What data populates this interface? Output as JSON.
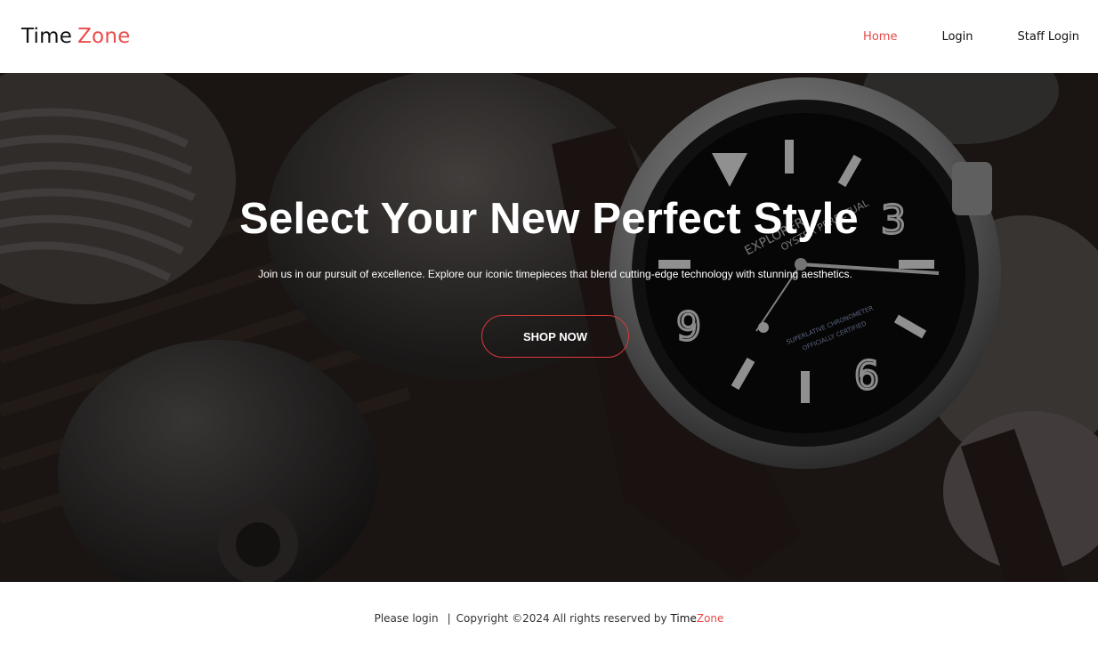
{
  "header": {
    "logo_part1": "Time",
    "logo_part2": "Zone",
    "nav": {
      "home": "Home",
      "login": "Login",
      "staff_login": "Staff Login"
    }
  },
  "hero": {
    "title": "Select Your New Perfect Style",
    "subtitle": "Join us in our pursuit of excellence. Explore our iconic timepieces that blend cutting-edge technology with stunning aesthetics.",
    "cta": "SHOP NOW",
    "watch_dial_brand": "OYSTER PERPETUAL",
    "watch_dial_model": "EXPLORER",
    "watch_dial_line1": "SUPERLATIVE CHRONOMETER",
    "watch_dial_line2": "OFFICIALLY CERTIFIED"
  },
  "footer": {
    "please_login": "Please login",
    "separator": "|",
    "copyright": "Copyright ©2024 All rights reserved by",
    "brand_part1": "Time",
    "brand_part2": "Zone"
  },
  "colors": {
    "accent": "#e84a4a",
    "cta_border": "#d93a3a",
    "text_dark": "#111111"
  }
}
